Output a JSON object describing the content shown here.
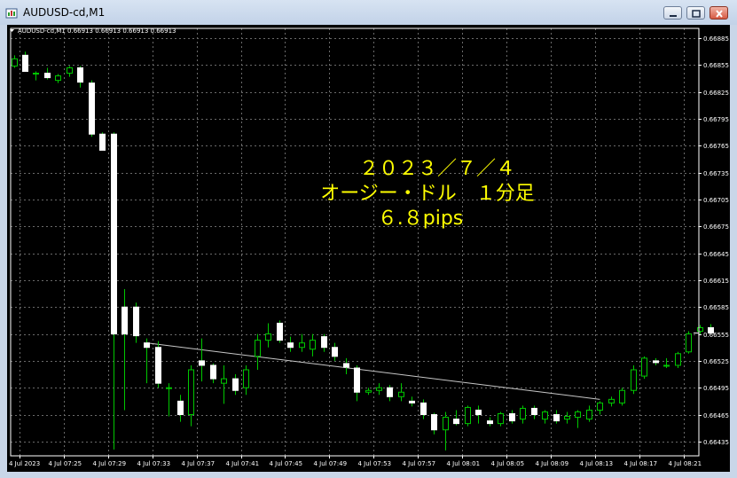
{
  "window": {
    "title": "AUDUSD-cd,M1"
  },
  "chart_data": {
    "type": "candlestick",
    "symbol_header": "AUDUSD-cd,M1  0.66913 0.66913 0.66913 0.66913",
    "ylim": [
      0.66419,
      0.66896
    ],
    "y_ticks": [
      "0.66885",
      "0.66855",
      "0.66825",
      "0.66795",
      "0.66765",
      "0.66735",
      "0.66705",
      "0.66675",
      "0.66645",
      "0.66615",
      "0.66585",
      "0.66555",
      "0.66525",
      "0.66495",
      "0.66465",
      "0.66435"
    ],
    "x_ticks": [
      "4 Jul 2023",
      "4 Jul 07:25",
      "4 Jul 07:29",
      "4 Jul 07:33",
      "4 Jul 07:37",
      "4 Jul 07:41",
      "4 Jul 07:45",
      "4 Jul 07:49",
      "4 Jul 07:53",
      "4 Jul 07:57",
      "4 Jul 08:01",
      "4 Jul 08:05",
      "4 Jul 08:09",
      "4 Jul 08:13",
      "4 Jul 08:17",
      "4 Jul 08:21"
    ],
    "bull_color": "#00c800",
    "bear_color": "#ffffff",
    "annotation_lines": [
      "２０２３／７／４",
      "オージー・ドル　１分足",
      "６.８pips"
    ],
    "annotation_color": "#ffff00",
    "candles": [
      {
        "o": 0.66854,
        "h": 0.66866,
        "l": 0.66852,
        "c": 0.66862
      },
      {
        "o": 0.66866,
        "h": 0.6687,
        "l": 0.66848,
        "c": 0.66848
      },
      {
        "o": 0.66846,
        "h": 0.66848,
        "l": 0.66838,
        "c": 0.66846
      },
      {
        "o": 0.66846,
        "h": 0.66852,
        "l": 0.66839,
        "c": 0.66841
      },
      {
        "o": 0.66838,
        "h": 0.66845,
        "l": 0.66835,
        "c": 0.66843
      },
      {
        "o": 0.66846,
        "h": 0.66854,
        "l": 0.66842,
        "c": 0.66852
      },
      {
        "o": 0.66852,
        "h": 0.66854,
        "l": 0.6683,
        "c": 0.66836
      },
      {
        "o": 0.66835,
        "h": 0.66838,
        "l": 0.66775,
        "c": 0.66778
      },
      {
        "o": 0.66778,
        "h": 0.6678,
        "l": 0.66762,
        "c": 0.6676
      },
      {
        "o": 0.66778,
        "h": 0.6678,
        "l": 0.66426,
        "c": 0.66555
      },
      {
        "o": 0.66585,
        "h": 0.66605,
        "l": 0.6647,
        "c": 0.66555
      },
      {
        "o": 0.66585,
        "h": 0.6659,
        "l": 0.66545,
        "c": 0.66553
      },
      {
        "o": 0.66545,
        "h": 0.6655,
        "l": 0.665,
        "c": 0.6654
      },
      {
        "o": 0.6654,
        "h": 0.66547,
        "l": 0.66495,
        "c": 0.665
      },
      {
        "o": 0.66495,
        "h": 0.665,
        "l": 0.66463,
        "c": 0.66495
      },
      {
        "o": 0.6648,
        "h": 0.66487,
        "l": 0.66457,
        "c": 0.66465
      },
      {
        "o": 0.66465,
        "h": 0.6652,
        "l": 0.66452,
        "c": 0.66515
      },
      {
        "o": 0.66525,
        "h": 0.6655,
        "l": 0.66502,
        "c": 0.6652
      },
      {
        "o": 0.6652,
        "h": 0.66522,
        "l": 0.665,
        "c": 0.66505
      },
      {
        "o": 0.665,
        "h": 0.6652,
        "l": 0.66477,
        "c": 0.66505
      },
      {
        "o": 0.66505,
        "h": 0.6651,
        "l": 0.66487,
        "c": 0.66492
      },
      {
        "o": 0.66495,
        "h": 0.6652,
        "l": 0.66487,
        "c": 0.66515
      },
      {
        "o": 0.6653,
        "h": 0.66555,
        "l": 0.66515,
        "c": 0.66548
      },
      {
        "o": 0.66548,
        "h": 0.66567,
        "l": 0.6654,
        "c": 0.66555
      },
      {
        "o": 0.66567,
        "h": 0.6657,
        "l": 0.66545,
        "c": 0.66548
      },
      {
        "o": 0.66545,
        "h": 0.66552,
        "l": 0.66535,
        "c": 0.6654
      },
      {
        "o": 0.6654,
        "h": 0.66555,
        "l": 0.66535,
        "c": 0.66545
      },
      {
        "o": 0.66538,
        "h": 0.66555,
        "l": 0.6653,
        "c": 0.66548
      },
      {
        "o": 0.66552,
        "h": 0.66555,
        "l": 0.66535,
        "c": 0.6654
      },
      {
        "o": 0.6654,
        "h": 0.66545,
        "l": 0.66525,
        "c": 0.6653
      },
      {
        "o": 0.66522,
        "h": 0.66528,
        "l": 0.6651,
        "c": 0.66518
      },
      {
        "o": 0.66517,
        "h": 0.6652,
        "l": 0.6648,
        "c": 0.6649
      },
      {
        "o": 0.6649,
        "h": 0.66495,
        "l": 0.66487,
        "c": 0.66492
      },
      {
        "o": 0.66492,
        "h": 0.665,
        "l": 0.66487,
        "c": 0.66495
      },
      {
        "o": 0.66495,
        "h": 0.66498,
        "l": 0.6648,
        "c": 0.66485
      },
      {
        "o": 0.66485,
        "h": 0.665,
        "l": 0.6648,
        "c": 0.6649
      },
      {
        "o": 0.6648,
        "h": 0.66485,
        "l": 0.66474,
        "c": 0.66478
      },
      {
        "o": 0.66478,
        "h": 0.66482,
        "l": 0.6646,
        "c": 0.66465
      },
      {
        "o": 0.66465,
        "h": 0.66467,
        "l": 0.66443,
        "c": 0.66448
      },
      {
        "o": 0.66448,
        "h": 0.66468,
        "l": 0.66425,
        "c": 0.66462
      },
      {
        "o": 0.6646,
        "h": 0.6647,
        "l": 0.66453,
        "c": 0.66455
      },
      {
        "o": 0.66455,
        "h": 0.66475,
        "l": 0.66452,
        "c": 0.66473
      },
      {
        "o": 0.6647,
        "h": 0.66475,
        "l": 0.66455,
        "c": 0.66465
      },
      {
        "o": 0.66458,
        "h": 0.66462,
        "l": 0.66452,
        "c": 0.66455
      },
      {
        "o": 0.66455,
        "h": 0.66468,
        "l": 0.66452,
        "c": 0.66466
      },
      {
        "o": 0.66466,
        "h": 0.6647,
        "l": 0.66455,
        "c": 0.66458
      },
      {
        "o": 0.6646,
        "h": 0.66475,
        "l": 0.66455,
        "c": 0.66472
      },
      {
        "o": 0.66472,
        "h": 0.66475,
        "l": 0.6646,
        "c": 0.66465
      },
      {
        "o": 0.6646,
        "h": 0.6647,
        "l": 0.66455,
        "c": 0.66468
      },
      {
        "o": 0.66465,
        "h": 0.6647,
        "l": 0.66455,
        "c": 0.66458
      },
      {
        "o": 0.6646,
        "h": 0.66468,
        "l": 0.66455,
        "c": 0.66463
      },
      {
        "o": 0.66462,
        "h": 0.6647,
        "l": 0.6645,
        "c": 0.66468
      },
      {
        "o": 0.6646,
        "h": 0.66475,
        "l": 0.66457,
        "c": 0.6647
      },
      {
        "o": 0.6647,
        "h": 0.6648,
        "l": 0.66465,
        "c": 0.66478
      },
      {
        "o": 0.66478,
        "h": 0.66485,
        "l": 0.66474,
        "c": 0.66482
      },
      {
        "o": 0.66478,
        "h": 0.66495,
        "l": 0.66475,
        "c": 0.66492
      },
      {
        "o": 0.66492,
        "h": 0.6652,
        "l": 0.66488,
        "c": 0.66515
      },
      {
        "o": 0.66508,
        "h": 0.6653,
        "l": 0.66505,
        "c": 0.66528
      },
      {
        "o": 0.66525,
        "h": 0.66528,
        "l": 0.6652,
        "c": 0.66523
      },
      {
        "o": 0.6652,
        "h": 0.66528,
        "l": 0.66517,
        "c": 0.6652
      },
      {
        "o": 0.6652,
        "h": 0.66535,
        "l": 0.66517,
        "c": 0.66533
      },
      {
        "o": 0.66535,
        "h": 0.66558,
        "l": 0.66533,
        "c": 0.66555
      },
      {
        "o": 0.66558,
        "h": 0.66565,
        "l": 0.66555,
        "c": 0.66562
      },
      {
        "o": 0.66562,
        "h": 0.66566,
        "l": 0.66556,
        "c": 0.66556
      }
    ],
    "trend_line": {
      "from": {
        "x_index": 12,
        "y": 0.66545
      },
      "to": {
        "x_index": 53,
        "y": 0.66482
      },
      "color": "#c8c8c8"
    }
  }
}
